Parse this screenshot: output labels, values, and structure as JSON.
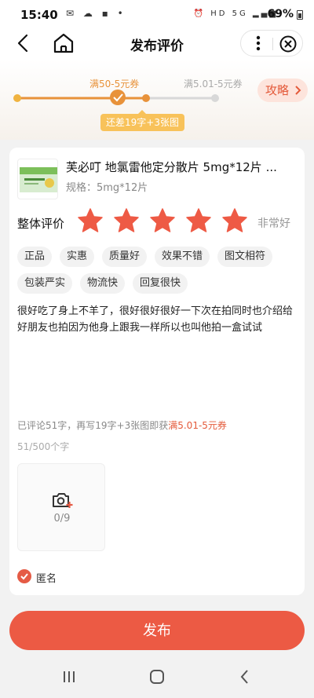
{
  "status_bar": {
    "time": "15:40",
    "net_labels": "HD 5G",
    "battery": "69%"
  },
  "header": {
    "title": "发布评价"
  },
  "progress": {
    "coupon_current": "满50-5元券",
    "coupon_next": "满5.01-5元券",
    "bubble": "还差19字+3张图",
    "strategy": "攻略",
    "accent": "#e8923a"
  },
  "product": {
    "name": "芙必叮 地氯雷他定分散片 5mg*12片 ...",
    "spec": "规格：5mg*12片"
  },
  "rating": {
    "label": "整体评价",
    "stars": 5,
    "max": 5,
    "text": "非常好",
    "star_color": "#ee5a45"
  },
  "tags": [
    "正品",
    "实惠",
    "质量好",
    "效果不错",
    "图文相符",
    "包装严实",
    "物流快",
    "回复很快"
  ],
  "review": {
    "text": "很好吃了身上不羊了，很好很好很好一下次在拍同时也介绍给好朋友也拍因为他身上跟我一样所以也叫他拍一盒试试",
    "hint_prefix": "已评论51字，再写19字+3张图即获",
    "hint_coupon": "满5.01-5元券",
    "count": "51/500个字"
  },
  "upload": {
    "count": "0/9"
  },
  "anonymous": {
    "label": "匿名",
    "checked": true
  },
  "publish": {
    "label": "发布"
  },
  "colors": {
    "brand": "#ec5a44",
    "bubble": "#f8c25a"
  }
}
